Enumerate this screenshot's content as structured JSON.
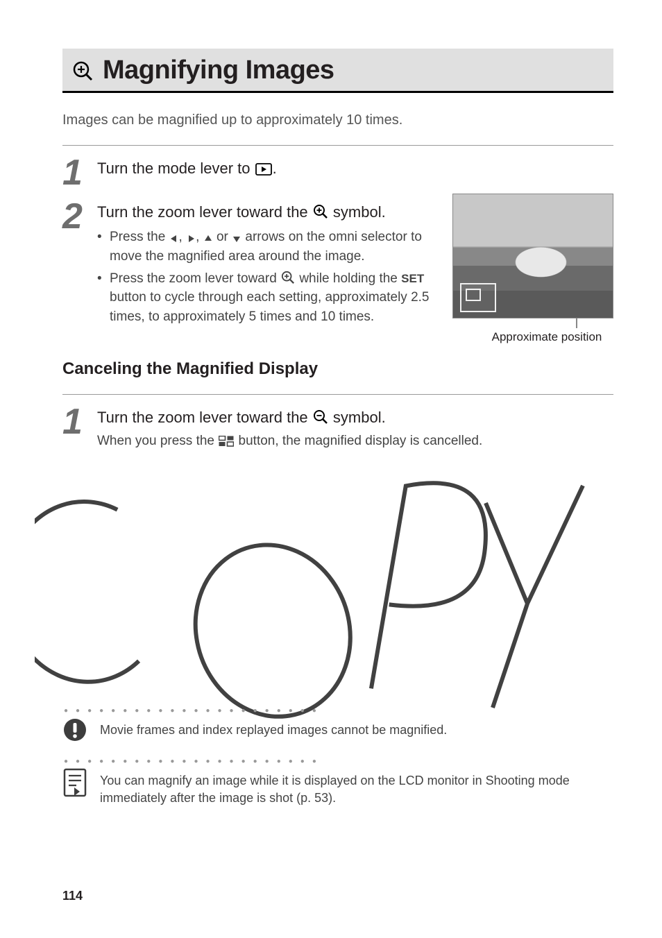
{
  "title": "Magnifying Images",
  "intro": "Images can be magnified up to approximately 10 times.",
  "step1": {
    "head_before": "Turn the mode lever to ",
    "head_after": "."
  },
  "step2": {
    "head_before": "Turn the zoom lever toward the ",
    "head_after": " symbol.",
    "bullet1_a": "Press the ",
    "bullet1_b": " arrows on the omni selector to move the magnified area around the image.",
    "bullet2_a": "Press the zoom lever toward ",
    "bullet2_b": " while holding the ",
    "set_label": "SET",
    "bullet2_c": " button to cycle through each setting, approximately 2.5 times, to approximately 5 times and 10 times."
  },
  "figure_caption": "Approximate position",
  "subhead": "Canceling the Magnified Display",
  "cancel": {
    "head_before": "Turn the zoom lever toward the ",
    "head_after": " symbol.",
    "desc_before": "When you press the ",
    "desc_after": " button, the magnified display is cancelled."
  },
  "note_important": "Movie frames and index replayed images cannot be magnified.",
  "note_memo": "You can magnify an image while it is displayed on the LCD monitor in Shooting mode immediately after the image is shot (p. 53).",
  "page_number": "114"
}
